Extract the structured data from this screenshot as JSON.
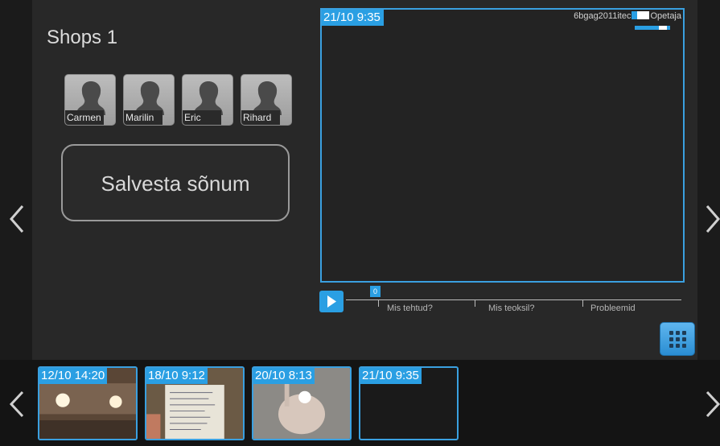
{
  "header": {
    "title": "Shops 1"
  },
  "participants": [
    {
      "name": "Carmen"
    },
    {
      "name": "Marilin"
    },
    {
      "name": "Eric"
    },
    {
      "name": "Rihard"
    }
  ],
  "actions": {
    "save_label": "Salvesta sõnum"
  },
  "video": {
    "timestamp": "21/10 9:35",
    "user_prefix": "6bgag2011itec",
    "user_role": "Opetaja",
    "volume_level": 0.8
  },
  "timeline": {
    "cursor_value": "0",
    "markers": [
      "Mis tehtud?",
      "Mis teoksil?",
      "Probleemid"
    ]
  },
  "thumbnails": [
    {
      "timestamp": "12/10 14:20"
    },
    {
      "timestamp": "18/10 9:12"
    },
    {
      "timestamp": "20/10 8:13"
    },
    {
      "timestamp": "21/10 9:35"
    }
  ],
  "colors": {
    "accent": "#2a9fe3",
    "background": "#282828",
    "dark": "#141414"
  },
  "icons": {
    "nav_left": "chevron-left-icon",
    "nav_right": "chevron-right-icon",
    "play": "play-icon",
    "grid": "grid-menu-icon",
    "avatar": "person-silhouette-icon"
  }
}
